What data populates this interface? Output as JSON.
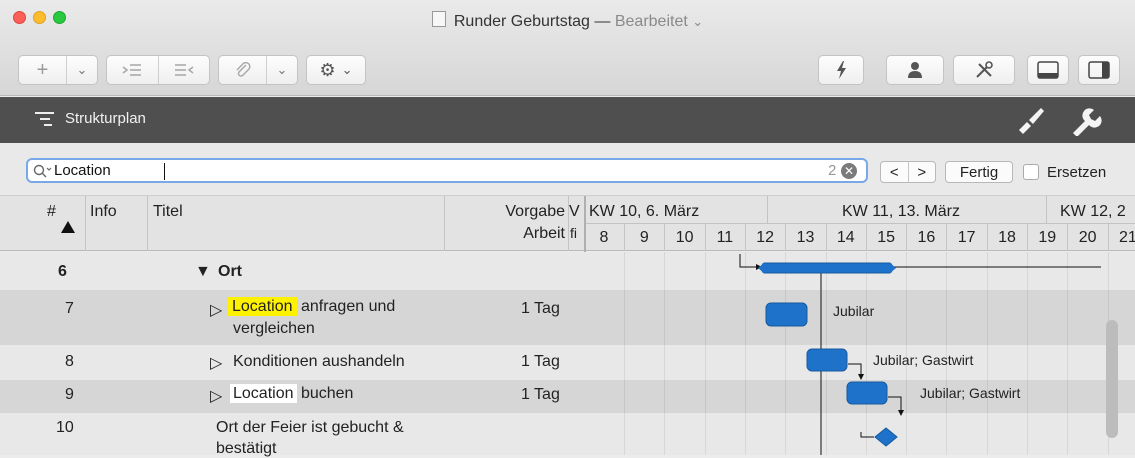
{
  "window": {
    "doc_title": "Runder Geburtstag",
    "separator": "—",
    "status": "Bearbeitet",
    "status_chevron": "⌄"
  },
  "toolbar": {
    "add": "+",
    "chevron": "⌄",
    "gear": "⚙"
  },
  "outline_bar": {
    "label": "Strukturplan"
  },
  "search": {
    "value": "Location",
    "count": "2",
    "prev": "<",
    "next": ">",
    "done": "Fertig",
    "replace": "Ersetzen"
  },
  "columns": {
    "num": "#",
    "info": "Info",
    "title": "Titel",
    "work_1": "Vorgabe",
    "work_2": "Arbeit",
    "narrow_1": "V",
    "narrow_2": "fi"
  },
  "gantt": {
    "weeks": [
      "KW 10, 6. März",
      "KW 11, 13. März",
      "KW 12, 2"
    ],
    "days": [
      "8",
      "9",
      "10",
      "11",
      "12",
      "13",
      "14",
      "15",
      "16",
      "17",
      "18",
      "19",
      "20",
      "21"
    ]
  },
  "rows": [
    {
      "num": "6",
      "title": "Ort",
      "work": "",
      "resource": ""
    },
    {
      "num": "7",
      "title_hl": "Location",
      "title_rest": "anfragen und",
      "title_2": "vergleichen",
      "work": "1 Tag",
      "resource": "Jubilar"
    },
    {
      "num": "8",
      "title": "Konditionen aushandeln",
      "work": "1 Tag",
      "resource": "Jubilar; Gastwirt"
    },
    {
      "num": "9",
      "title_hl": "Location",
      "title_rest": "buchen",
      "work": "1 Tag",
      "resource": "Jubilar; Gastwirt"
    },
    {
      "num": "10",
      "title": "Ort der Feier ist gebucht &",
      "title_2": "bestätigt",
      "work": "",
      "resource": ""
    }
  ],
  "colors": {
    "accent": "#1f72c9",
    "highlight": "#fff200",
    "header_dark": "#4f4f4f"
  }
}
